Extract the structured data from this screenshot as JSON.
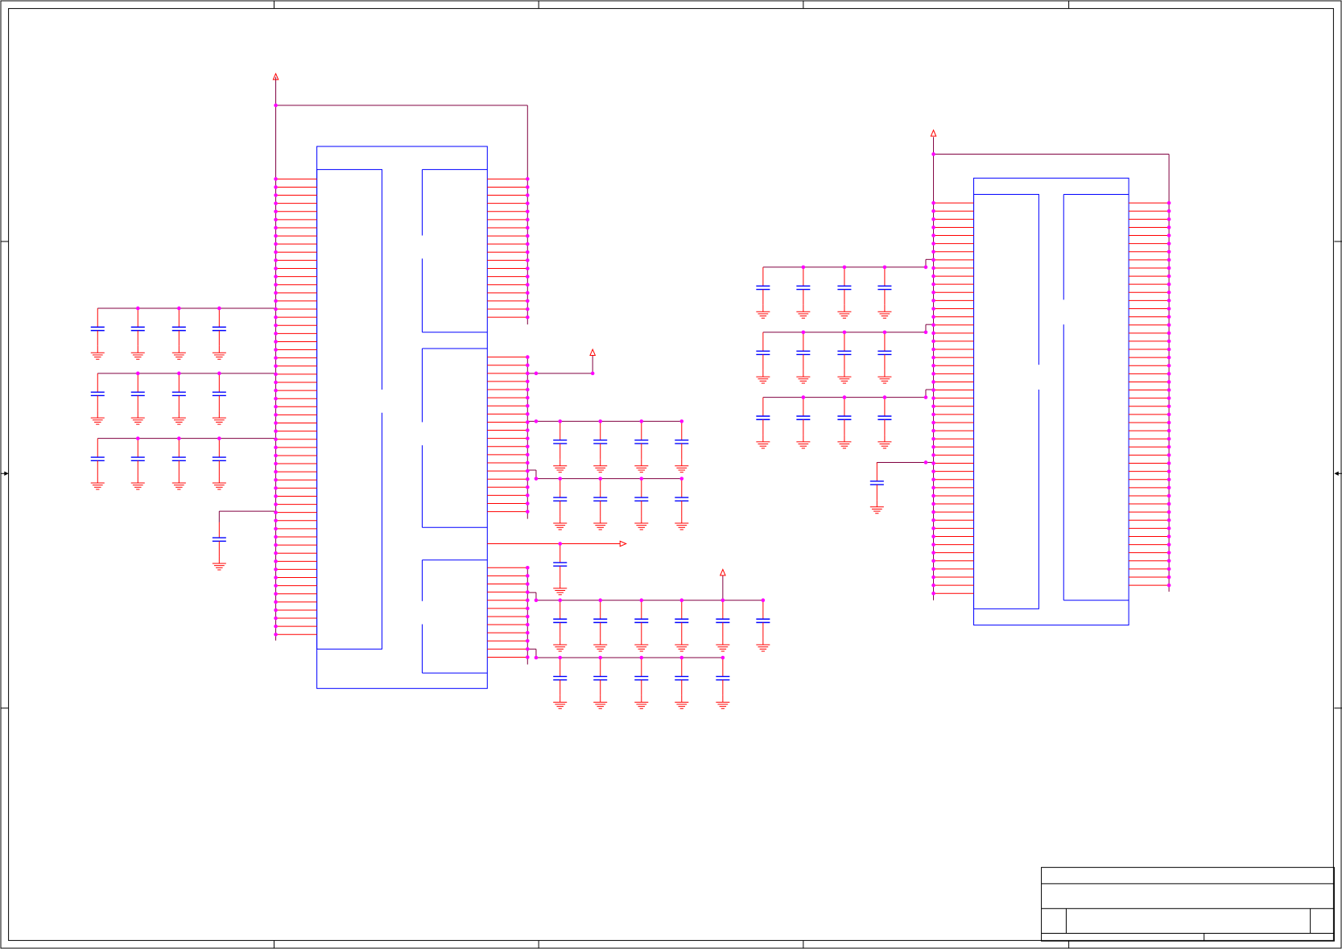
{
  "colors": {
    "background": "#ffffff",
    "frame": "#000000",
    "part_outline": "#0000ff",
    "wire": "#800040",
    "pin": "#ff0000",
    "junction": "#ff00ff",
    "capacitor_plate": "#0000ff"
  },
  "legend": {
    "supply_arrow": "power-port-icon",
    "ground": "ground-icon",
    "capacitor": "capacitor-icon",
    "junction": "junction-dot-icon",
    "off_sheet": "off-sheet-arrow-icon"
  },
  "title_block": {
    "title": "",
    "subtitle": "",
    "size": "",
    "document_number": "",
    "revision": "",
    "date": "",
    "sheet": ""
  }
}
